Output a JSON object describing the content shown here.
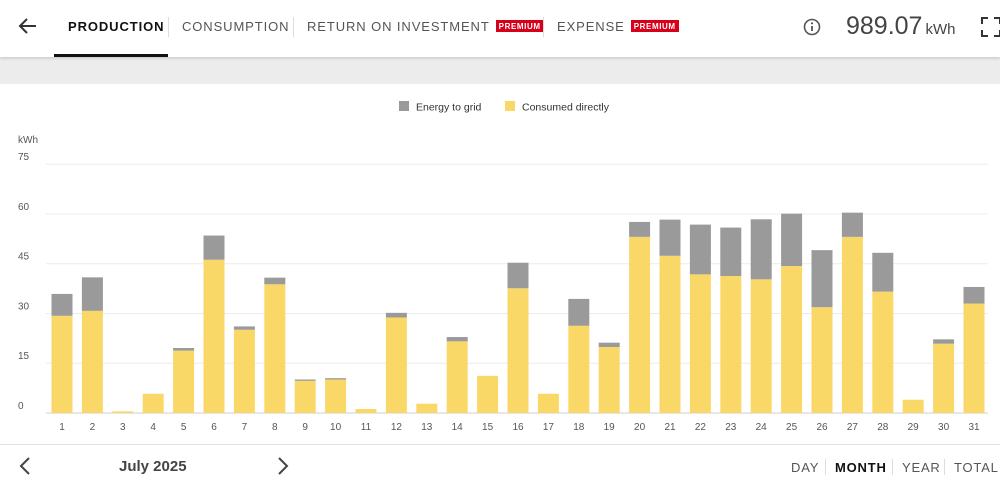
{
  "tabs": [
    {
      "label": "PRODUCTION",
      "active": true,
      "badge": ""
    },
    {
      "label": "CONSUMPTION",
      "active": false,
      "badge": ""
    },
    {
      "label": "RETURN ON INVESTMENT",
      "active": false,
      "badge": "PREMIUM"
    },
    {
      "label": "EXPENSE",
      "active": false,
      "badge": "PREMIUM"
    }
  ],
  "header": {
    "total_value": "989.07",
    "total_unit": "kWh",
    "icons": {
      "back": "arrow-left-icon",
      "info": "info-icon",
      "fullscreen": "fullscreen-icon"
    }
  },
  "chart_data": {
    "type": "bar",
    "stacked": true,
    "categories": [
      "1",
      "2",
      "3",
      "4",
      "5",
      "6",
      "7",
      "8",
      "9",
      "10",
      "11",
      "12",
      "13",
      "14",
      "15",
      "16",
      "17",
      "18",
      "19",
      "20",
      "21",
      "22",
      "23",
      "24",
      "25",
      "26",
      "27",
      "28",
      "29",
      "30",
      "31"
    ],
    "series": [
      {
        "name": "Consumed directly",
        "color": "#f9d868",
        "values": [
          29.3,
          30.8,
          0.5,
          5.8,
          18.8,
          46.2,
          25.1,
          38.8,
          9.7,
          10.1,
          1.2,
          28.8,
          2.8,
          21.6,
          11.2,
          37.6,
          5.8,
          26.3,
          19.9,
          53.1,
          47.4,
          41.8,
          41.3,
          40.3,
          44.3,
          31.9,
          53.1,
          36.6,
          4.0,
          20.9,
          33.0
        ]
      },
      {
        "name": "Energy to grid",
        "color": "#9a9a9a",
        "values": [
          6.6,
          10.1,
          0.0,
          0.0,
          0.8,
          7.3,
          1.0,
          2.0,
          0.4,
          0.4,
          0.0,
          1.4,
          0.0,
          1.3,
          0.0,
          7.7,
          0.0,
          8.1,
          1.3,
          4.5,
          10.9,
          15.0,
          14.6,
          18.1,
          15.8,
          17.2,
          7.3,
          11.7,
          0.0,
          1.3,
          5.0
        ]
      }
    ],
    "legend": [
      {
        "label": "Energy to grid",
        "color": "#9a9a9a"
      },
      {
        "label": "Consumed directly",
        "color": "#f9d868"
      }
    ],
    "legend_position": "top-center",
    "ylabel": "kWh",
    "yticks": [
      0,
      15,
      30,
      45,
      60,
      75
    ],
    "ylim": [
      0,
      77
    ],
    "grid": true
  },
  "footer": {
    "period": "July 2025",
    "ranges": [
      {
        "label": "DAY",
        "active": false
      },
      {
        "label": "MONTH",
        "active": true
      },
      {
        "label": "YEAR",
        "active": false
      },
      {
        "label": "TOTAL",
        "active": false
      }
    ],
    "icons": {
      "prev": "chevron-left-icon",
      "next": "chevron-right-icon"
    }
  }
}
